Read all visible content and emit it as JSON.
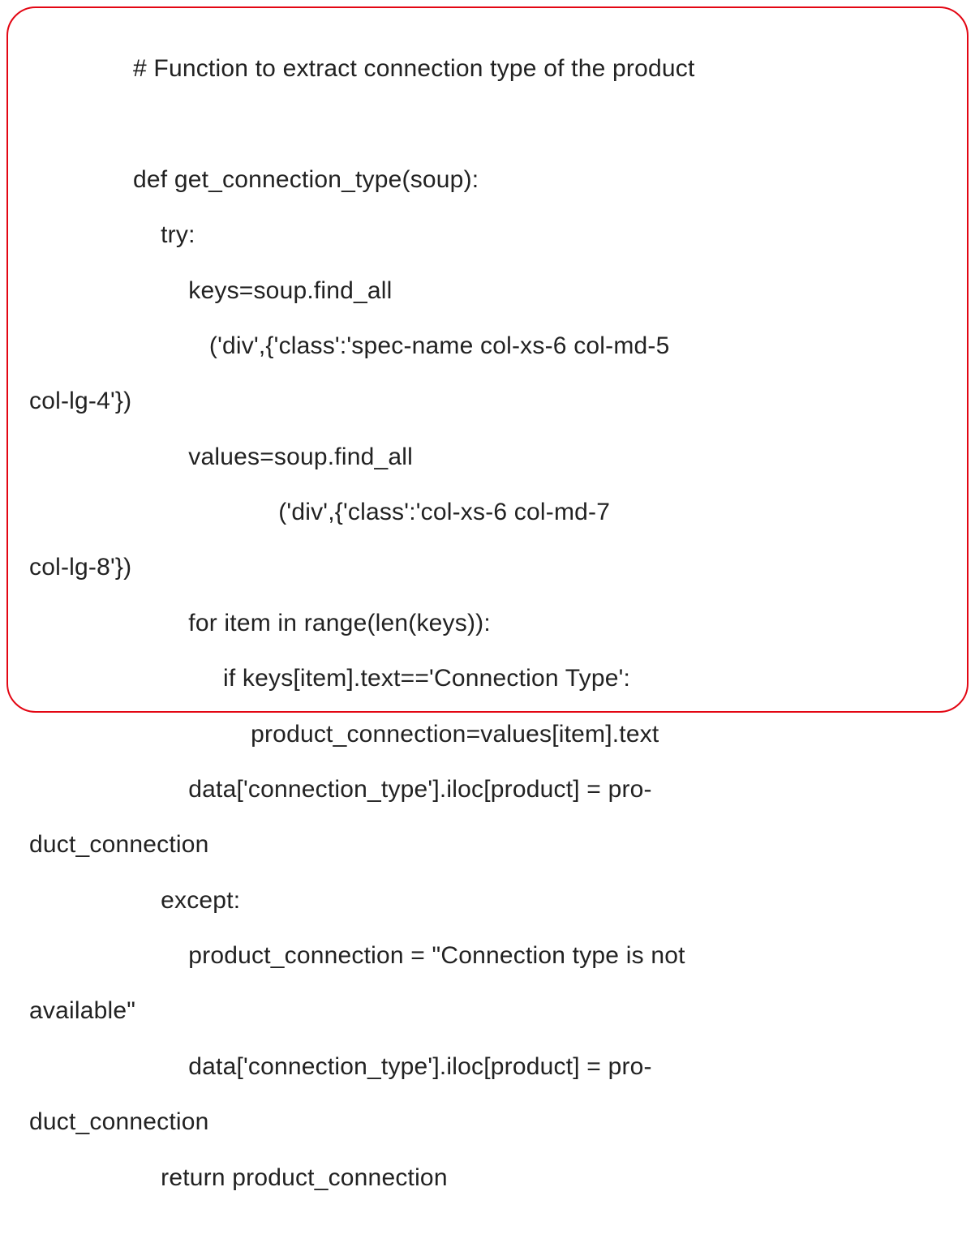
{
  "code": {
    "l01": "# Function to extract connection type of the product",
    "l02": "",
    "l03": "def get_connection_type(soup):",
    "l04": "    try:  ",
    "l05": "        keys=soup.find_all",
    "l06": "           ('div',{'class':'spec-name col-xs-6 col-md-5 ",
    "l06w": "col-lg-4'})",
    "l07": "        values=soup.find_all",
    "l08": "                     ('div',{'class':'col-xs-6 col-md-7 ",
    "l08w": "col-lg-8'})",
    "l09": "        for item in range(len(keys)):",
    "l10": "             if keys[item].text=='Connection Type':",
    "l11": "                 product_connection=values[item].text",
    "l12": "        data['connection_type'].iloc[product] = pro-",
    "l12w": "duct_connection",
    "l13": "    except:",
    "l14": "        product_connection = \"Connection type is not ",
    "l14w": "available\"",
    "l15": "        data['connection_type'].iloc[product] = pro-",
    "l15w": "duct_connection",
    "l16": "    return product_connection"
  }
}
